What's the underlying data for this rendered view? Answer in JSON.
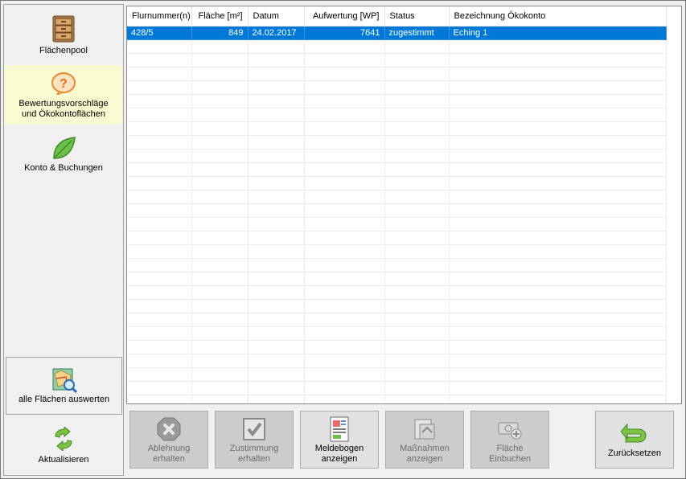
{
  "sidebar": {
    "items": [
      {
        "label": "Flächenpool"
      },
      {
        "label_line1": "Bewertungsvorschläge",
        "label_line2": "und Ökokontoflächen"
      },
      {
        "label": "Konto & Buchungen"
      }
    ],
    "evaluate_all": "alle Flächen auswerten",
    "refresh": "Aktualisieren"
  },
  "table": {
    "columns": [
      "Flurnummer(n)",
      "Fläche [m²]",
      "Datum",
      "Aufwertung [WP]",
      "Status",
      "Bezeichnung Ökokonto"
    ],
    "rows": [
      {
        "flurnummer": "428/5",
        "flaeche": "849",
        "datum": "24.02.2017",
        "aufwertung": "7641",
        "status": "zugestimmt",
        "bezeichnung": "Eching 1"
      }
    ]
  },
  "actions": [
    {
      "line1": "Ablehnung",
      "line2": "erhalten",
      "enabled": false
    },
    {
      "line1": "Zustimmung",
      "line2": "erhalten",
      "enabled": false
    },
    {
      "line1": "Meldebogen",
      "line2": "anzeigen",
      "enabled": true
    },
    {
      "line1": "Maßnahmen",
      "line2": "anzeigen",
      "enabled": false
    },
    {
      "line1": "Fläche",
      "line2": "Einbuchen",
      "enabled": false
    },
    {
      "line1": "Zurücksetzen",
      "enabled": true
    }
  ],
  "colors": {
    "selection": "#0078d7",
    "nav_selected": "#fafad2",
    "button_disabled": "#cccccc",
    "button_enabled": "#e1e1e1"
  }
}
